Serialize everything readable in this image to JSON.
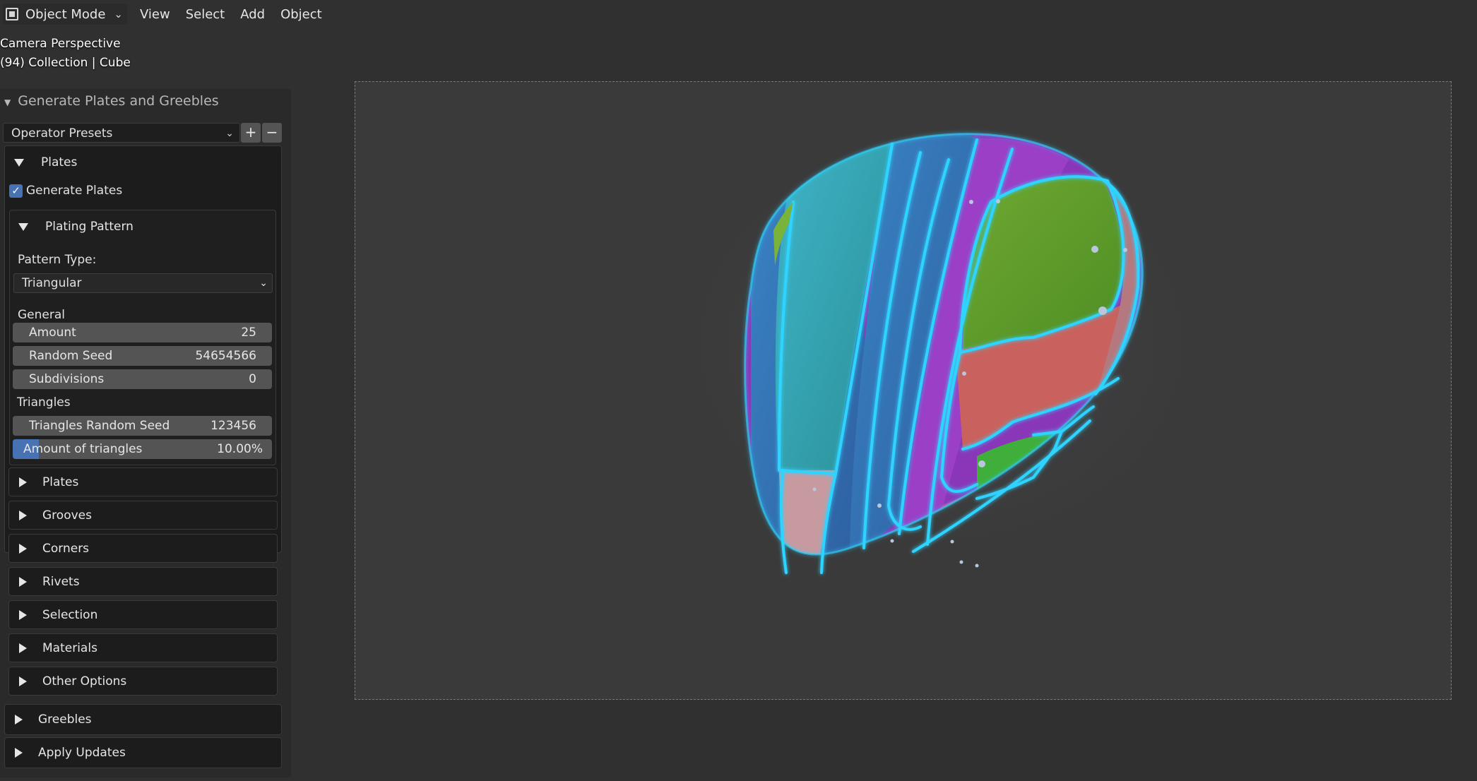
{
  "header": {
    "mode": "Object Mode",
    "menus": [
      "View",
      "Select",
      "Add",
      "Object"
    ]
  },
  "viewport_info": {
    "line1": "Camera Perspective",
    "line2": "(94) Collection | Cube"
  },
  "operator_panel": {
    "title": "Generate Plates and Greebles",
    "presets_label": "Operator Presets",
    "add_label": "+",
    "remove_label": "−",
    "plates_section": {
      "label": "Plates",
      "generate_plates_label": "Generate Plates",
      "generate_plates_checked": true,
      "plating_pattern": {
        "label": "Plating Pattern",
        "pattern_type_label": "Pattern Type:",
        "pattern_type_value": "Triangular",
        "general_label": "General",
        "amount": {
          "label": "Amount",
          "value": "25"
        },
        "random_seed": {
          "label": "Random Seed",
          "value": "54654566"
        },
        "subdivisions": {
          "label": "Subdivisions",
          "value": "0"
        },
        "triangles_label": "Triangles",
        "triangles_random_seed": {
          "label": "Triangles Random Seed",
          "value": "123456"
        },
        "amount_of_triangles": {
          "label": "Amount of triangles",
          "value": "10.00%",
          "fraction": 0.1
        }
      },
      "subsections": [
        "Plates",
        "Grooves",
        "Corners",
        "Rivets",
        "Selection",
        "Materials",
        "Other Options"
      ]
    },
    "greebles_label": "Greebles",
    "apply_updates_label": "Apply Updates"
  },
  "colors": {
    "accent_blue": "#4772b3",
    "panel_bg": "#2a2a2a",
    "viewport_bg": "#3a3a3a",
    "glow_cyan": "#2fd4ff"
  }
}
